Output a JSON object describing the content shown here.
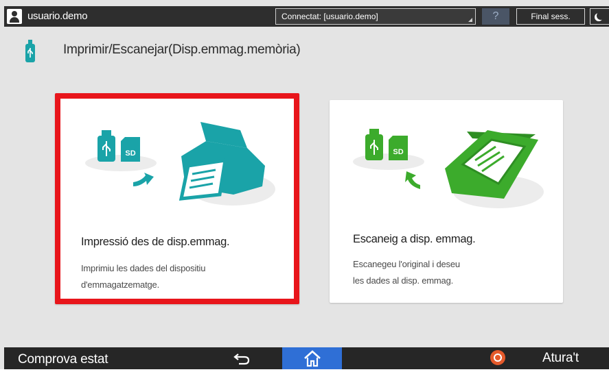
{
  "header": {
    "username": "usuario.demo",
    "connection_status": "Connectat: [usuario.demo]",
    "help_label": "?",
    "logout_label": "Final sess."
  },
  "page": {
    "title": "Imprimir/Escanejar(Disp.emmag.memòria)"
  },
  "cards": {
    "print": {
      "title": "Impressió des de disp.emmag.",
      "desc_line1": "Imprimiu les dades del dispositiu",
      "desc_line2": "d'emmagatzematge.",
      "badge": "SD",
      "color": "#1aa3a8",
      "selected": true
    },
    "scan": {
      "title": "Escaneig a disp. emmag.",
      "desc_line1": "Escanegeu l'original i deseu",
      "desc_line2": "les dades al disp. emmag.",
      "badge": "SD",
      "color": "#3cab2c"
    }
  },
  "footer": {
    "status_label": "Comprova estat",
    "stop_label": "Atura't"
  },
  "icons": {
    "user": "user-icon",
    "usb": "usb-icon",
    "back": "back-arrow-icon",
    "home": "home-icon",
    "stop": "stop-icon",
    "moon": "moon-icon"
  },
  "colors": {
    "selection": "#e8151b",
    "home_active": "#2f6fd6",
    "print_accent": "#1aa3a8",
    "scan_accent": "#3cab2c"
  }
}
